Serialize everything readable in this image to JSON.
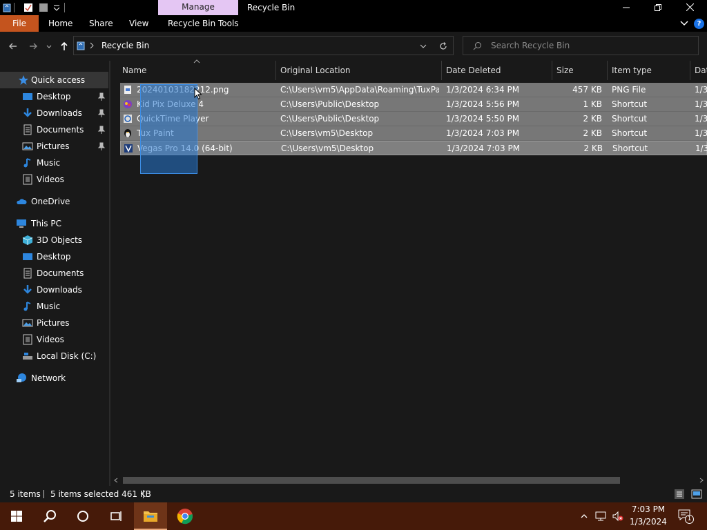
{
  "titlebar": {
    "manage_tab": "Manage",
    "window_title": "Recycle Bin"
  },
  "ribbon": {
    "tabs": [
      "File",
      "Home",
      "Share",
      "View",
      "Recycle Bin Tools"
    ],
    "help": "?"
  },
  "address": {
    "path": "Recycle Bin",
    "search_placeholder": "Search Recycle Bin"
  },
  "sidebar": {
    "quick_access": "Quick access",
    "quick_items": [
      "Desktop",
      "Downloads",
      "Documents",
      "Pictures",
      "Music",
      "Videos"
    ],
    "onedrive": "OneDrive",
    "this_pc": "This PC",
    "pc_items": [
      "3D Objects",
      "Desktop",
      "Documents",
      "Downloads",
      "Music",
      "Pictures",
      "Videos",
      "Local Disk (C:)"
    ],
    "network": "Network"
  },
  "columns": [
    "Name",
    "Original Location",
    "Date Deleted",
    "Size",
    "Item type",
    "Dat"
  ],
  "files": [
    {
      "name": "20240103182212.png",
      "location": "C:\\Users\\vm5\\AppData\\Roaming\\TuxPai...",
      "date": "1/3/2024 6:34 PM",
      "size": "457 KB",
      "type": "PNG File",
      "extra": "1/3"
    },
    {
      "name": "Kid Pix Deluxe 4",
      "location": "C:\\Users\\Public\\Desktop",
      "date": "1/3/2024 5:56 PM",
      "size": "1 KB",
      "type": "Shortcut",
      "extra": "1/3"
    },
    {
      "name": "QuickTime Player",
      "location": "C:\\Users\\Public\\Desktop",
      "date": "1/3/2024 5:50 PM",
      "size": "2 KB",
      "type": "Shortcut",
      "extra": "1/3"
    },
    {
      "name": "Tux Paint",
      "location": "C:\\Users\\vm5\\Desktop",
      "date": "1/3/2024 7:03 PM",
      "size": "2 KB",
      "type": "Shortcut",
      "extra": "1/3"
    },
    {
      "name": "Vegas Pro 14.0 (64-bit)",
      "location": "C:\\Users\\vm5\\Desktop",
      "date": "1/3/2024 7:03 PM",
      "size": "2 KB",
      "type": "Shortcut",
      "extra": "1/3"
    }
  ],
  "status": {
    "items": "5 items",
    "selected": "5 items selected  461 KB"
  },
  "taskbar": {
    "time": "7:03 PM",
    "date": "1/3/2024",
    "notification_count": "1"
  },
  "colors": {
    "accent_file_tab": "#c4541e",
    "manage_tab": "#e4c6f3",
    "selection": "#777777",
    "taskbar": "#461a09"
  }
}
